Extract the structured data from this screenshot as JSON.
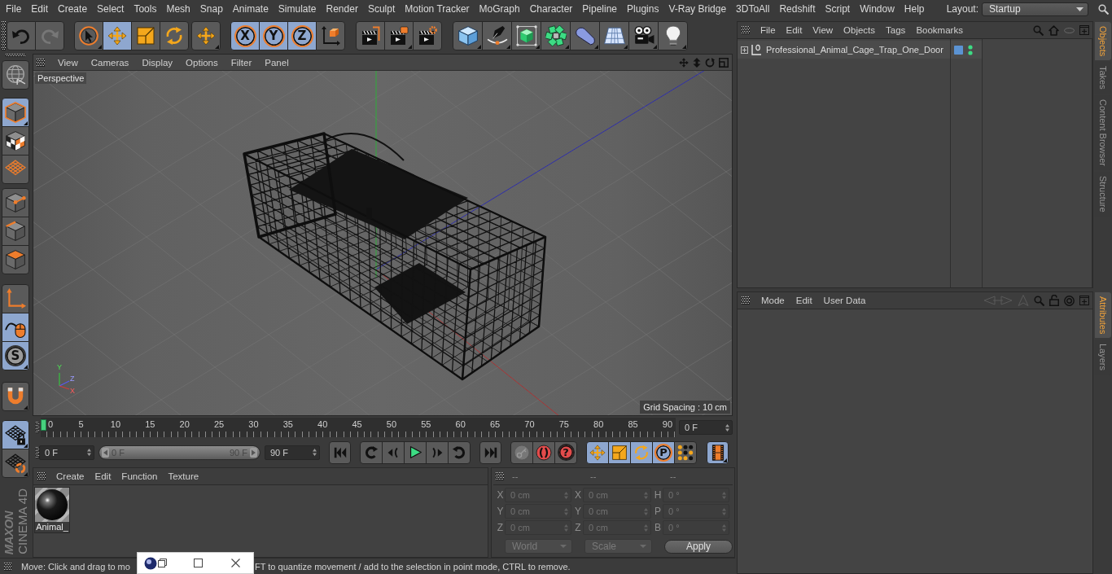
{
  "menubar": {
    "items": [
      "File",
      "Edit",
      "Create",
      "Select",
      "Tools",
      "Mesh",
      "Snap",
      "Animate",
      "Simulate",
      "Render",
      "Sculpt",
      "Motion Tracker",
      "MoGraph",
      "Character",
      "Pipeline",
      "Plugins",
      "V-Ray Bridge",
      "3DToAll",
      "Redshift",
      "Script",
      "Window",
      "Help"
    ],
    "layout_label": "Layout:",
    "layout_value": "Startup"
  },
  "toolbar": {
    "history": [
      {
        "disabled": false
      },
      {
        "disabled": true
      }
    ],
    "tools": [
      {
        "selected": false
      },
      {
        "selected": true
      },
      {
        "selected": false
      },
      {
        "selected": false
      }
    ],
    "axes": [
      {
        "label": "X",
        "selected": true
      },
      {
        "label": "Y",
        "selected": true
      },
      {
        "label": "Z",
        "selected": true
      }
    ]
  },
  "sidebar": {
    "groups": [
      {
        "items": [
          {
            "selected": true
          },
          {
            "selected": false
          },
          {
            "selected": false
          }
        ]
      },
      {
        "items": [
          {
            "selected": false
          },
          {
            "selected": false
          },
          {
            "selected": false
          }
        ]
      },
      {
        "items": [
          {
            "selected": false
          },
          {
            "selected": true
          },
          {
            "label": "S",
            "selected": true
          }
        ]
      },
      {
        "items": [
          {
            "selected": false
          }
        ]
      },
      {
        "items": [
          {
            "selected": true
          },
          {
            "selected": false
          }
        ]
      }
    ]
  },
  "brand": {
    "maker": "MAXON",
    "product": "CINEMA 4D"
  },
  "viewport": {
    "menu": [
      "View",
      "Cameras",
      "Display",
      "Options",
      "Filter",
      "Panel"
    ],
    "camera": "Perspective",
    "grid_spacing": "Grid Spacing : 10 cm",
    "axis_labels": [
      "Y",
      "Z",
      "X"
    ]
  },
  "timeline": {
    "ticks": [
      "0",
      "5",
      "10",
      "15",
      "20",
      "25",
      "30",
      "35",
      "40",
      "45",
      "50",
      "55",
      "60",
      "65",
      "70",
      "75",
      "80",
      "85",
      "90"
    ],
    "playhead": {
      "level": 0
    },
    "current_frame": "0 F"
  },
  "playback": {
    "start_field": "0 F",
    "range": {
      "start": "0 F",
      "end": "90 F",
      "level": 1
    },
    "end_field": "90 F",
    "help_label": "?",
    "key_filters": [
      {
        "selected": true
      },
      {
        "selected": true
      },
      {
        "selected": true
      },
      {
        "label": "P",
        "selected": true
      },
      {
        "selected": false
      }
    ],
    "film_toggle": {
      "selected": true
    }
  },
  "materials": {
    "menu": [
      "Create",
      "Edit",
      "Function",
      "Texture"
    ],
    "items": [
      {
        "name": "Animal_"
      }
    ]
  },
  "coordinates": {
    "disabled": true,
    "headers": [
      "--",
      "--",
      "--"
    ],
    "rows": [
      {
        "cells": [
          {
            "axis": "X",
            "value": "0 cm"
          },
          {
            "axis": "X",
            "value": "0 cm"
          },
          {
            "axis": "H",
            "value": "0 °"
          }
        ]
      },
      {
        "cells": [
          {
            "axis": "Y",
            "value": "0 cm"
          },
          {
            "axis": "Y",
            "value": "0 cm"
          },
          {
            "axis": "P",
            "value": "0 °"
          }
        ]
      },
      {
        "cells": [
          {
            "axis": "Z",
            "value": "0 cm"
          },
          {
            "axis": "Z",
            "value": "0 cm"
          },
          {
            "axis": "B",
            "value": "0 °"
          }
        ]
      }
    ],
    "mode": "World",
    "size_mode": "Scale",
    "apply": "Apply"
  },
  "status_bar": {
    "segments": [
      "Move: Click and drag to mo",
      "FT to quantize movement / add to the selection in point mode, CTRL to remove."
    ]
  },
  "objects_manager": {
    "menu": [
      "File",
      "Edit",
      "View",
      "Objects",
      "Tags",
      "Bookmarks"
    ],
    "objects": [
      {
        "name": "Professional_Animal_Cage_Trap_One_Door",
        "expanded": false
      }
    ]
  },
  "attributes_manager": {
    "menu": [
      "Mode",
      "Edit",
      "User Data"
    ]
  },
  "side_tabs": {
    "top": [
      {
        "label": "Objects",
        "selected": true
      },
      {
        "label": "Takes",
        "selected": false
      },
      {
        "label": "Content Browser",
        "selected": false
      },
      {
        "label": "Structure",
        "selected": false
      }
    ],
    "bottom": [
      {
        "label": "Attributes",
        "selected": true
      },
      {
        "label": "Layers",
        "selected": false
      }
    ]
  }
}
